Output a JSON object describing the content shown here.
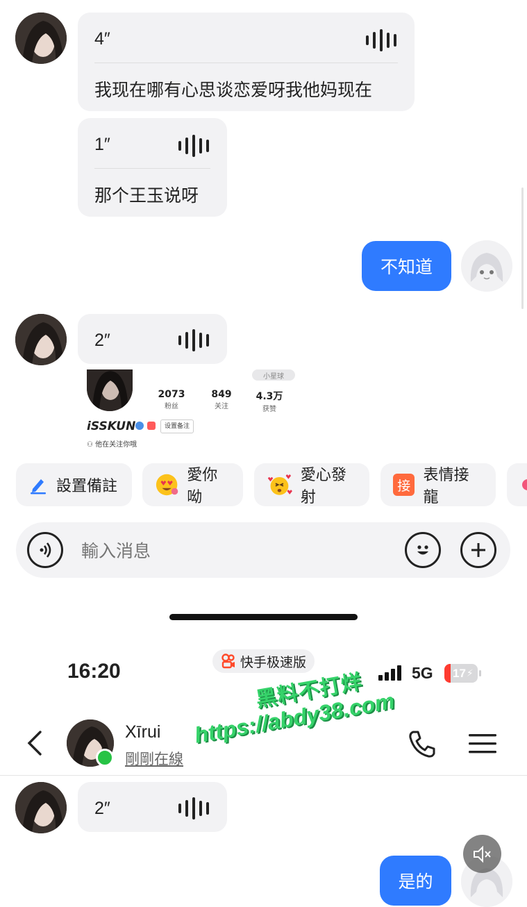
{
  "top_chat": {
    "voice1": {
      "duration": "4″",
      "transcript": "我现在哪有心思谈恋爱呀我他妈现在"
    },
    "voice2": {
      "duration": "1″",
      "transcript": "那个王玉说呀"
    },
    "my_message": "不知道",
    "voice3": {
      "duration": "2″"
    },
    "profile_card": {
      "tag": "小星球",
      "username": "iSSKUN",
      "fans_value": "2073",
      "fans_label": "粉丝",
      "following_value": "849",
      "following_label": "关注",
      "likes_value": "4.3万",
      "likes_label": "获赞",
      "remark_button": "设置备注",
      "follow_note": "他在关注你哦"
    },
    "quick_actions": [
      {
        "label": "設置備註",
        "icon": "pencil-icon"
      },
      {
        "label": "愛你呦",
        "icon": "heart-eyes-emoji-icon"
      },
      {
        "label": "愛心發射",
        "icon": "hearts-emoji-icon"
      },
      {
        "label": "表情接龍",
        "icon_text": "接"
      }
    ],
    "input": {
      "placeholder": "輸入消息"
    }
  },
  "bottom_chat": {
    "status_bar": {
      "time": "16:20",
      "app_badge": "快手极速版",
      "network": "5G",
      "battery": "17"
    },
    "header": {
      "name": "Xīrui",
      "status": "剛剛在線"
    },
    "voice": {
      "duration": "2″"
    },
    "my_message": "是的"
  },
  "watermark": {
    "line1": "黑料不打烊",
    "line2": "https://abdy38.com"
  },
  "colors": {
    "accent": "#2f7bff",
    "online": "#27c345",
    "bubble": "#f2f2f4",
    "watermark": "#36d36a"
  }
}
